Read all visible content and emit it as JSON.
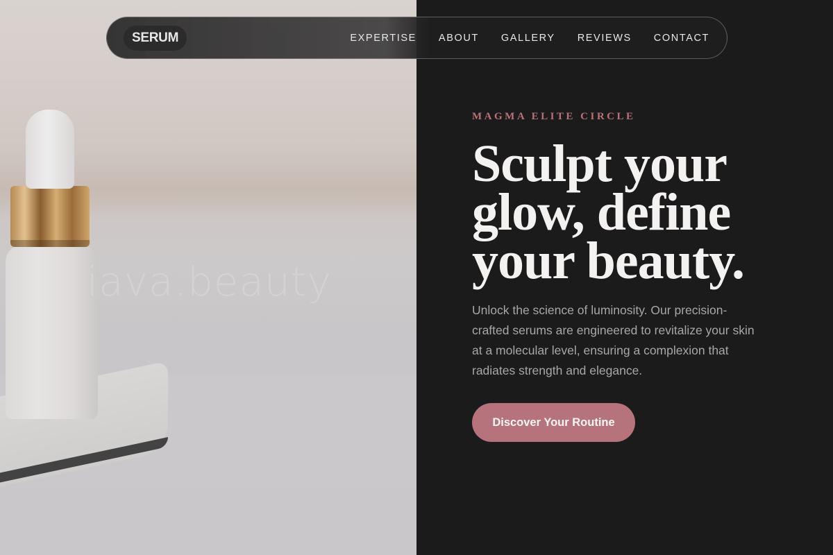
{
  "nav": {
    "brand": "SERUM",
    "items": [
      {
        "label": "EXPERTISE"
      },
      {
        "label": "ABOUT"
      },
      {
        "label": "GALLERY"
      },
      {
        "label": "REVIEWS"
      },
      {
        "label": "CONTACT"
      }
    ]
  },
  "hero": {
    "eyebrow": "MAGMA ELITE CIRCLE",
    "headline_lines": [
      "Sculpt your",
      "glow, define",
      "your beauty."
    ],
    "body": "Unlock the science of luminosity. Our precision-crafted serums are engineered to revitalize your skin at a molecular level, ensuring a complexion that radiates strength and elegance.",
    "cta_label": "Discover Your Routine"
  },
  "photo": {
    "watermark": "iava.beauty"
  },
  "colors": {
    "accent": "#b7737b",
    "background_dark": "#1c1b1c",
    "headline": "#f4f2f1",
    "body_text": "#a9a6a6"
  }
}
